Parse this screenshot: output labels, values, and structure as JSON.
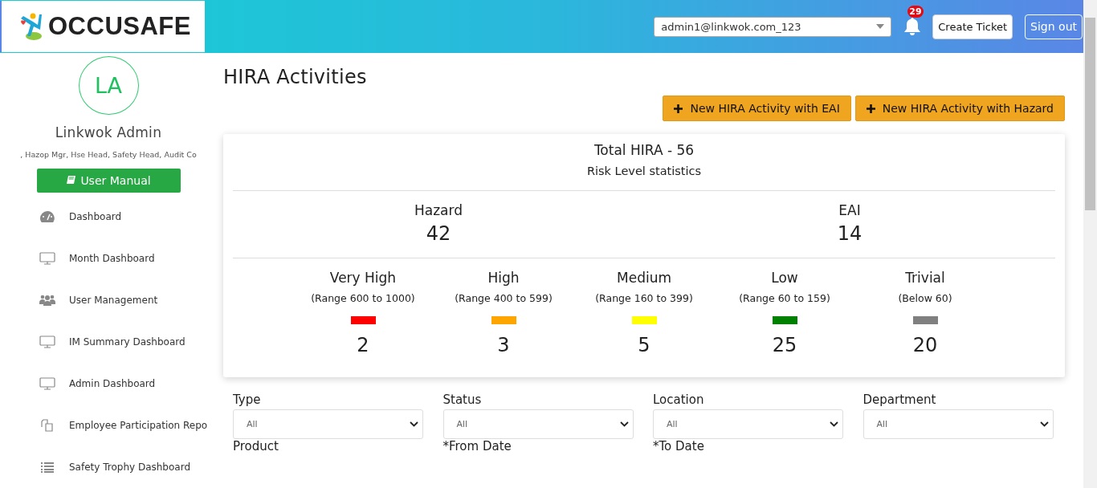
{
  "header": {
    "logo_text": "OCCUSAFE",
    "account_select": {
      "value": "admin1@linkwok.com_123"
    },
    "notifications": {
      "count": "29"
    },
    "buttons": [
      "Create Ticket",
      "Sign out"
    ]
  },
  "sidebar": {
    "avatar_initials": "LA",
    "user_name": "Linkwok Admin",
    "roles": ", Hazop Mgr, Hse Head, Safety Head, Audit Co",
    "manual_button": "User Manual",
    "items": [
      {
        "label": "Dashboard"
      },
      {
        "label": "Month Dashboard"
      },
      {
        "label": "User Management"
      },
      {
        "label": "IM Summary Dashboard"
      },
      {
        "label": "Admin Dashboard"
      },
      {
        "label": "Employee Participation Repo"
      },
      {
        "label": "Safety Trophy Dashboard"
      }
    ]
  },
  "page_title": "HIRA Activities",
  "actions": [
    "New HIRA Activity with EAI",
    "New HIRA Activity with Hazard"
  ],
  "stats": {
    "total": "Total HIRA - 56",
    "subtitle": "Risk Level statistics",
    "categories": [
      {
        "label": "Hazard",
        "count": "42"
      },
      {
        "label": "EAI",
        "count": "14"
      }
    ],
    "levels": [
      {
        "name": "Very High",
        "range": "(Range 600 to 1000)",
        "color": "#ff0000",
        "count": "2"
      },
      {
        "name": "High",
        "range": "(Range 400 to 599)",
        "color": "#ffa500",
        "count": "3"
      },
      {
        "name": "Medium",
        "range": "(Range 160 to 399)",
        "color": "#ffff00",
        "count": "5"
      },
      {
        "name": "Low",
        "range": "(Range 60 to 159)",
        "color": "#008000",
        "count": "25"
      },
      {
        "name": "Trivial",
        "range": "(Below 60)",
        "color": "#808080",
        "count": "20"
      }
    ]
  },
  "filters": [
    {
      "label": "Type",
      "value": "All"
    },
    {
      "label": "Status",
      "value": "All"
    },
    {
      "label": "Location",
      "value": "All"
    },
    {
      "label": "Department",
      "value": "All"
    }
  ],
  "next_filter_labels": [
    "Product",
    "*From Date",
    "*To Date"
  ]
}
